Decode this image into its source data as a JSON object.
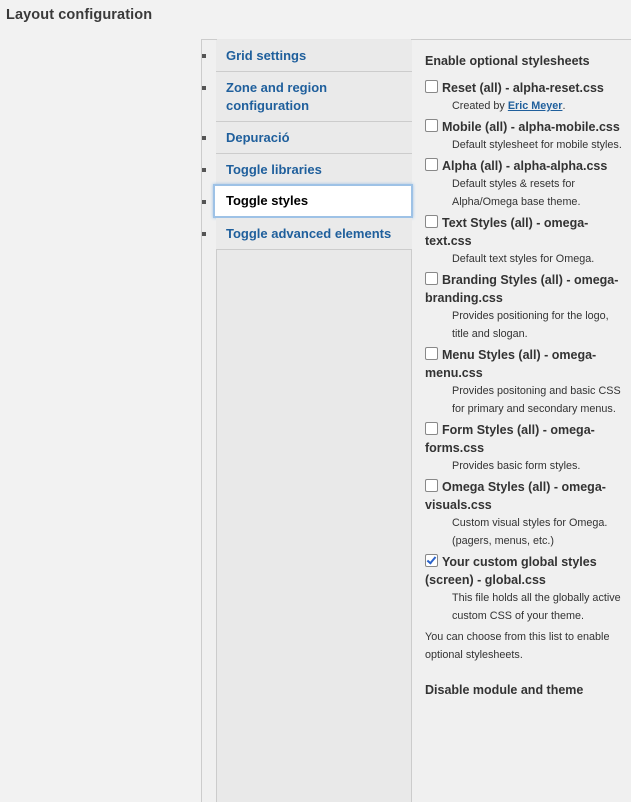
{
  "page": {
    "title": "Layout configuration"
  },
  "tabs": [
    {
      "label": "Grid settings"
    },
    {
      "label": "Zone and region configuration"
    },
    {
      "label": "Depuració"
    },
    {
      "label": "Toggle libraries"
    },
    {
      "label": "Toggle styles",
      "selected": true
    },
    {
      "label": "Toggle advanced elements"
    }
  ],
  "pane": {
    "heading": "Enable optional stylesheets",
    "options": [
      {
        "label": "Reset (all) - alpha-reset.css",
        "checked": false,
        "desc_prefix": "Created by ",
        "desc_link": "Eric Meyer",
        "desc_suffix": "."
      },
      {
        "label": "Mobile (all) - alpha-mobile.css",
        "checked": false,
        "desc": "Default stylesheet for mobile styles."
      },
      {
        "label": "Alpha (all) - alpha-alpha.css",
        "checked": false,
        "desc": "Default styles & resets for Alpha/Omega base theme."
      },
      {
        "label": "Text Styles (all) - omega-text.css",
        "checked": false,
        "desc": "Default text styles for Omega."
      },
      {
        "label": "Branding Styles (all) - omega-branding.css",
        "checked": false,
        "desc": "Provides positioning for the logo, title and slogan."
      },
      {
        "label": "Menu Styles (all) - omega-menu.css",
        "checked": false,
        "desc": "Provides positoning and basic CSS for primary and secondary menus."
      },
      {
        "label": "Form Styles (all) - omega-forms.css",
        "checked": false,
        "desc": "Provides basic form styles."
      },
      {
        "label": "Omega Styles (all) - omega-visuals.css",
        "checked": false,
        "desc": "Custom visual styles for Omega. (pagers, menus, etc.)"
      },
      {
        "label": "Your custom global styles (screen) - global.css",
        "checked": true,
        "desc": "This file holds all the globally active custom CSS of your theme."
      }
    ],
    "help": "You can choose from this list to enable optional stylesheets.",
    "heading2": "Disable module and theme"
  }
}
